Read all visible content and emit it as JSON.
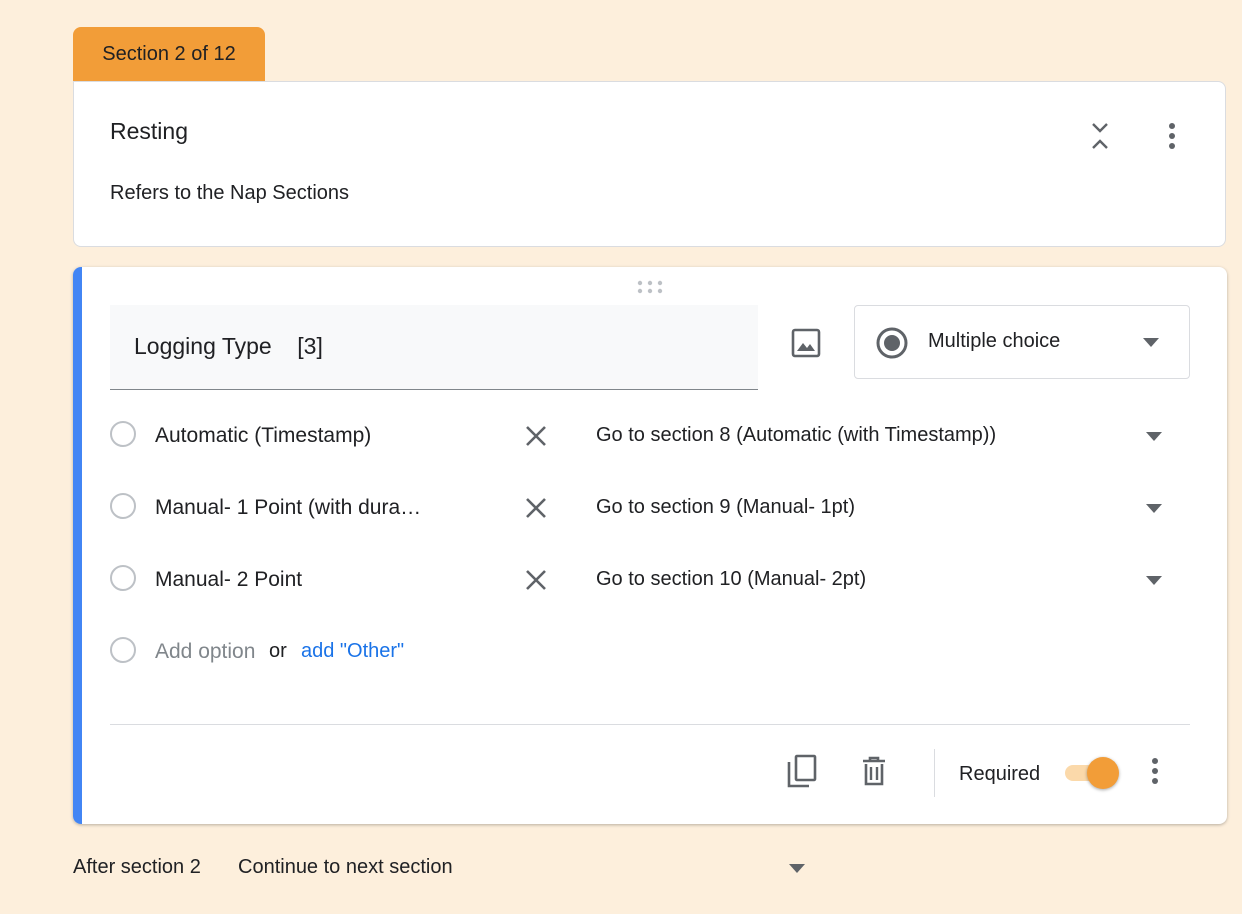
{
  "section": {
    "tab_label": "Section 2 of 12",
    "title": "Resting",
    "description": "Refers to the Nap Sections",
    "collapse_icon": "collapse-icon",
    "more_icon": "more-vert-icon"
  },
  "question": {
    "title": "Logging Type    [3]",
    "type": "Multiple choice",
    "accent_color": "#4285f4",
    "options": [
      {
        "label": "Automatic (Timestamp)",
        "goto": "Go to section 8 (Automatic (with Timestamp))"
      },
      {
        "label": "Manual- 1 Point (with dura…",
        "goto": "Go to section 9 (Manual- 1pt)"
      },
      {
        "label": "Manual- 2 Point",
        "goto": "Go to section 10 (Manual- 2pt)"
      }
    ],
    "add_option": "Add option",
    "or": "or",
    "add_other": "add \"Other\"",
    "required_label": "Required",
    "required": true
  },
  "after_section": {
    "label": "After section 2",
    "value": "Continue to next section"
  },
  "colors": {
    "background": "#fdefdc",
    "section_tab": "#f29d38",
    "toggle_on": "#f29d38",
    "link": "#1a73e8"
  }
}
